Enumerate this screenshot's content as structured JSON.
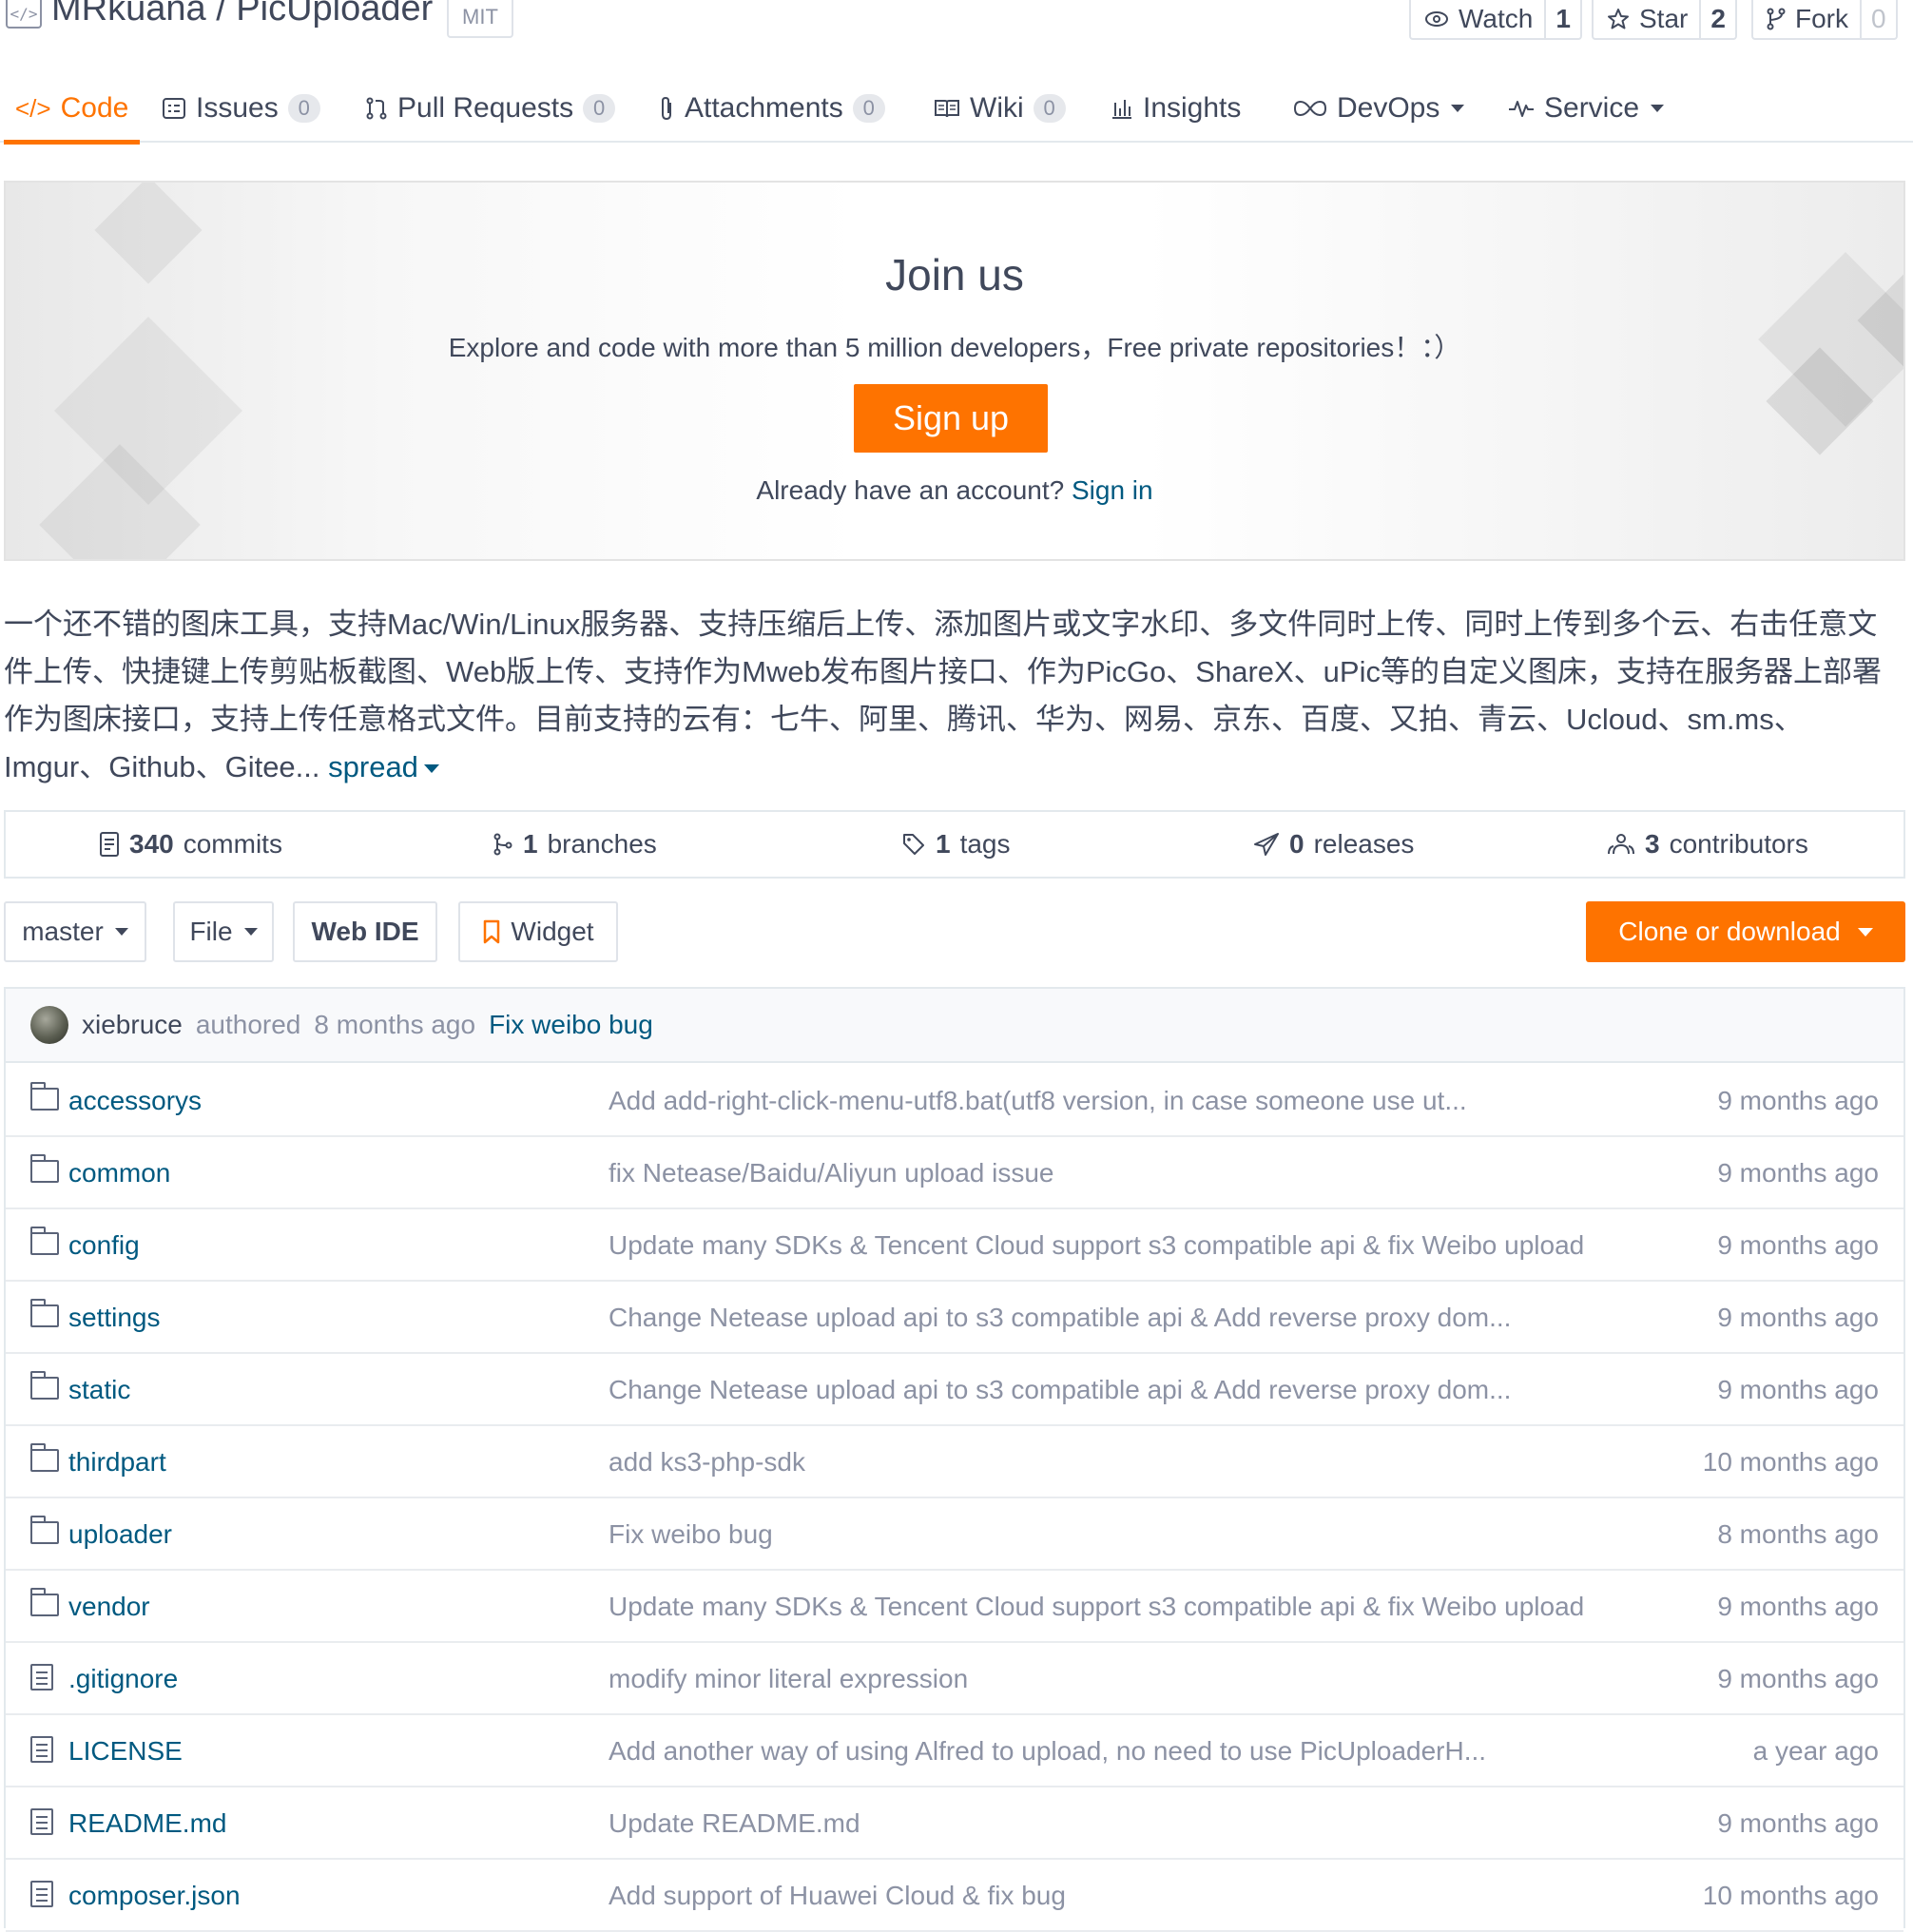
{
  "repo": {
    "title": "MRkuana / PicUploader",
    "license": "MIT"
  },
  "social": {
    "watch": {
      "label": "Watch",
      "count": "1"
    },
    "star": {
      "label": "Star",
      "count": "2"
    },
    "fork": {
      "label": "Fork",
      "count": "0"
    }
  },
  "nav": {
    "tabs": [
      {
        "label": "Code",
        "icon": "code-icon"
      },
      {
        "label": "Issues",
        "count": "0",
        "icon": "issues-icon"
      },
      {
        "label": "Pull Requests",
        "count": "0",
        "icon": "pull-request-icon"
      },
      {
        "label": "Attachments",
        "count": "0",
        "icon": "paperclip-icon"
      },
      {
        "label": "Wiki",
        "count": "0",
        "icon": "book-icon"
      },
      {
        "label": "Insights",
        "icon": "bar-chart-icon"
      },
      {
        "label": "DevOps",
        "icon": "infinity-icon"
      },
      {
        "label": "Service",
        "icon": "pulse-icon"
      }
    ],
    "active_color": "#fe7300"
  },
  "banner": {
    "title": "Join us",
    "subtitle": "Explore and code with more than 5 million developers，Free private repositories！：）",
    "signup_label": "Sign up",
    "account_prompt": "Already have an account?",
    "signin_label": "Sign in"
  },
  "description": {
    "text": "一个还不错的图床工具，支持Mac/Win/Linux服务器、支持压缩后上传、添加图片或文字水印、多文件同时上传、同时上传到多个云、右击任意文件上传、快捷键上传剪贴板截图、Web版上传、支持作为Mweb发布图片接口、作为PicGo、ShareX、uPic等的自定义图床，支持在服务器上部署作为图床接口，支持上传任意格式文件。目前支持的云有：七牛、阿里、腾讯、华为、网易、京东、百度、又拍、青云、Ucloud、sm.ms、Imgur、Github、Gitee...",
    "spread_label": "spread"
  },
  "stats": {
    "commits": {
      "count": "340",
      "label": "commits"
    },
    "branches": {
      "count": "1",
      "label": "branches"
    },
    "tags": {
      "count": "1",
      "label": "tags"
    },
    "releases": {
      "count": "0",
      "label": "releases"
    },
    "contributors": {
      "count": "3",
      "label": "contributors"
    }
  },
  "toolbar": {
    "branch": "master",
    "file": "File",
    "web_ide": "Web IDE",
    "widget": "Widget",
    "clone": "Clone or download"
  },
  "last_commit": {
    "author": "xiebruce",
    "action": "authored",
    "time": "8 months ago",
    "message": "Fix weibo bug"
  },
  "files": [
    {
      "name": "accessorys",
      "type": "folder",
      "message": "Add add-right-click-menu-utf8.bat(utf8 version, in case someone use ut...",
      "time": "9 months ago"
    },
    {
      "name": "common",
      "type": "folder",
      "message": "fix Netease/Baidu/Aliyun upload issue",
      "time": "9 months ago"
    },
    {
      "name": "config",
      "type": "folder",
      "message": "Update many SDKs & Tencent Cloud support s3 compatible api & fix Weibo upload",
      "time": "9 months ago"
    },
    {
      "name": "settings",
      "type": "folder",
      "message": "Change Netease upload api to s3 compatible api & Add reverse proxy dom...",
      "time": "9 months ago"
    },
    {
      "name": "static",
      "type": "folder",
      "message": "Change Netease upload api to s3 compatible api & Add reverse proxy dom...",
      "time": "9 months ago"
    },
    {
      "name": "thirdpart",
      "type": "folder",
      "message": "add ks3-php-sdk",
      "time": "10 months ago"
    },
    {
      "name": "uploader",
      "type": "folder",
      "message": "Fix weibo bug",
      "time": "8 months ago"
    },
    {
      "name": "vendor",
      "type": "folder",
      "message": "Update many SDKs & Tencent Cloud support s3 compatible api & fix Weibo upload",
      "time": "9 months ago"
    },
    {
      "name": ".gitignore",
      "type": "file",
      "message": "modify minor literal expression",
      "time": "9 months ago"
    },
    {
      "name": "LICENSE",
      "type": "file",
      "message": "Add another way of using Alfred to upload, no need to use PicUploaderH...",
      "time": "a year ago"
    },
    {
      "name": "README.md",
      "type": "file",
      "message": "Update README.md",
      "time": "9 months ago"
    },
    {
      "name": "composer.json",
      "type": "file",
      "message": "Add support of Huawei Cloud & fix bug",
      "time": "10 months ago"
    }
  ]
}
